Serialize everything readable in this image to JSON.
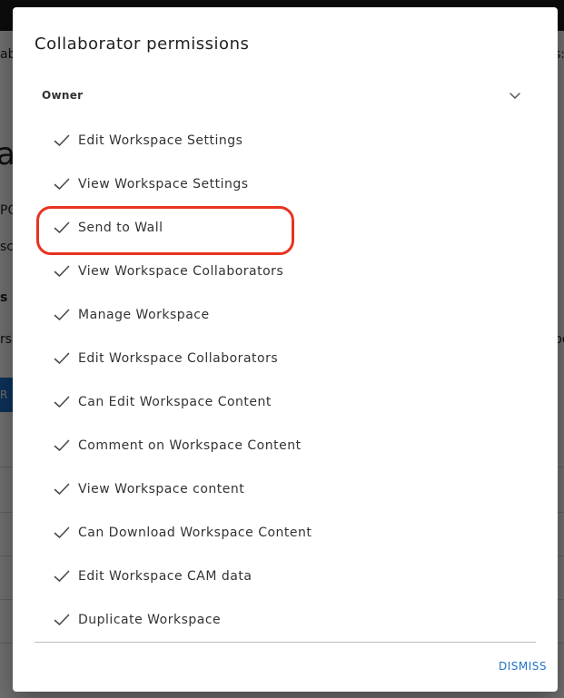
{
  "background": {
    "fragments": [
      "abr",
      "a",
      "PO",
      "sca",
      "s",
      "rs",
      "R",
      "s:",
      "po"
    ]
  },
  "dialog": {
    "title": "Collaborator permissions",
    "section": {
      "label": "Owner",
      "expanded": true
    },
    "permissions": [
      {
        "label": "Edit Workspace Settings",
        "checked": true
      },
      {
        "label": "View Workspace Settings",
        "checked": true
      },
      {
        "label": "Send to Wall",
        "checked": true,
        "highlighted": true
      },
      {
        "label": "View Workspace Collaborators",
        "checked": true
      },
      {
        "label": "Manage Workspace",
        "checked": true
      },
      {
        "label": "Edit Workspace Collaborators",
        "checked": true
      },
      {
        "label": "Can Edit Workspace Content",
        "checked": true
      },
      {
        "label": "Comment on Workspace Content",
        "checked": true
      },
      {
        "label": "View Workspace content",
        "checked": true
      },
      {
        "label": "Can Download Workspace Content",
        "checked": true
      },
      {
        "label": "Edit Workspace CAM data",
        "checked": true
      },
      {
        "label": "Duplicate Workspace",
        "checked": true
      }
    ],
    "dismiss_label": "DISMISS"
  },
  "colors": {
    "accent": "#1e73c8",
    "highlight": "#e8331e",
    "text": "#333333"
  }
}
